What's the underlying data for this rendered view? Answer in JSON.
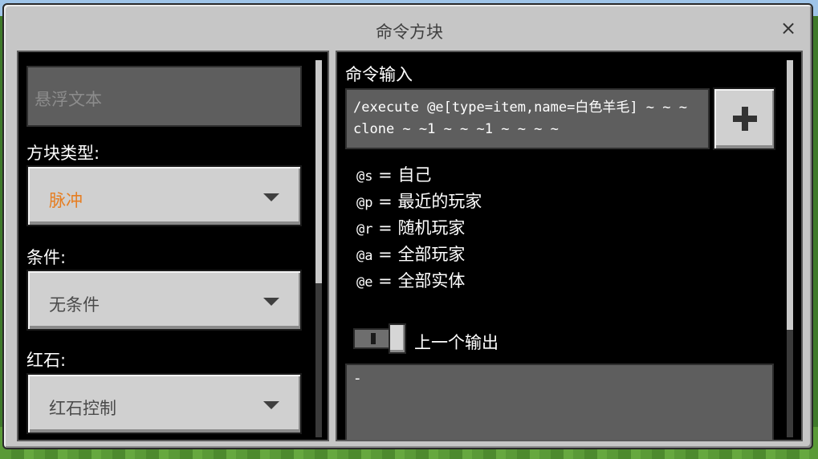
{
  "window": {
    "title": "命令方块",
    "close_label": "×"
  },
  "left_panel": {
    "hover_text_placeholder": "悬浮文本",
    "block_type": {
      "label": "方块类型:",
      "value": "脉冲"
    },
    "condition": {
      "label": "条件:",
      "value": "无条件"
    },
    "redstone": {
      "label": "红石:",
      "value": "红石控制"
    }
  },
  "right_panel": {
    "command_label": "命令输入",
    "command_value": "/execute @e[type=item,name=白色羊毛] ~ ~ ~ clone ~ ~1 ~ ~ ~1 ~ ~ ~ ~",
    "add_button_icon": "plus-icon",
    "help": [
      {
        "selector": "@s",
        "sep": " = ",
        "desc": "自己"
      },
      {
        "selector": "@p",
        "sep": " = ",
        "desc": "最近的玩家"
      },
      {
        "selector": "@r",
        "sep": " = ",
        "desc": "随机玩家"
      },
      {
        "selector": "@a",
        "sep": " = ",
        "desc": "全部玩家"
      },
      {
        "selector": "@e",
        "sep": " = ",
        "desc": "全部实体"
      }
    ],
    "previous_output": {
      "label": "上一个输出",
      "value": "-"
    }
  },
  "colors": {
    "dialog_bg": "#c6c6c6",
    "panel_bg": "#000000",
    "accent_orange": "#e67e22"
  }
}
